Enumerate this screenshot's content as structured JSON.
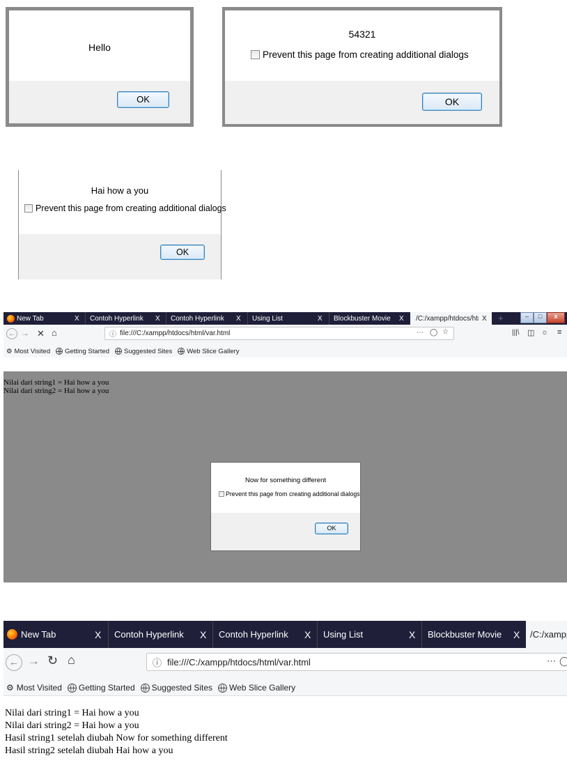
{
  "dialog1": {
    "message": "Hello",
    "ok_label": "OK"
  },
  "dialog2": {
    "message": "54321",
    "checkbox_label": "Prevent this page from creating additional dialogs",
    "ok_label": "OK"
  },
  "dialog3": {
    "message": "Hai how a you",
    "checkbox_label": "Prevent this page from creating additional dialogs",
    "ok_label": "OK"
  },
  "browser1": {
    "tabs": [
      {
        "label": "New Tab",
        "close": "X"
      },
      {
        "label": "Contoh Hyperlink",
        "close": "X"
      },
      {
        "label": "Contoh Hyperlink",
        "close": "X"
      },
      {
        "label": "Using List",
        "close": "X"
      },
      {
        "label": "Blockbuster Movie",
        "close": "X"
      },
      {
        "label": "/C:/xampp/htdocs/htm",
        "close": "X"
      }
    ],
    "new_tab_glyph": "+",
    "url": "file:///C:/xampp/htdocs/html/var.html",
    "bookmarks": [
      "Most Visited",
      "Getting Started",
      "Suggested Sites",
      "Web Slice Gallery"
    ],
    "content_lines": [
      "Nilai dari string1 = Hai how a you",
      "Nilai dari string2 = Hai how a you"
    ],
    "dialog": {
      "message": "Now for something different",
      "checkbox_label": "Prevent this page from creating additional dialogs",
      "ok_label": "OK"
    }
  },
  "browser2": {
    "tabs": [
      {
        "label": "New Tab",
        "close": "X"
      },
      {
        "label": "Contoh Hyperlink",
        "close": "X"
      },
      {
        "label": "Contoh Hyperlink",
        "close": "X"
      },
      {
        "label": "Using List",
        "close": "X"
      },
      {
        "label": "Blockbuster Movie",
        "close": "X"
      },
      {
        "label": "/C:/xampp",
        "close": ""
      }
    ],
    "url": "file:///C:/xampp/htdocs/html/var.html",
    "bookmarks": [
      "Most Visited",
      "Getting Started",
      "Suggested Sites",
      "Web Slice Gallery"
    ],
    "content_lines": [
      "Nilai dari string1 = Hai how a you",
      "Nilai dari string2 = Hai how a you",
      "Hasil string1 setelah diubah Now for something different",
      "Hasil string2 setelah diubah Hai how a you"
    ]
  },
  "colors": {
    "tabbar": "#1f1f3a",
    "overlay": "#8a8a8a",
    "ok_border": "#3c7fb1",
    "dialog_footer": "#f0f0f0"
  },
  "icons": [
    "back-icon",
    "forward-icon",
    "stop-icon",
    "reload-icon",
    "home-icon",
    "info-icon",
    "page-actions-icon",
    "pocket-icon",
    "star-icon",
    "library-icon",
    "sidebar-icon",
    "account-icon",
    "menu-icon",
    "gear-icon",
    "globe-icon",
    "firefox-icon",
    "checkbox-icon"
  ]
}
